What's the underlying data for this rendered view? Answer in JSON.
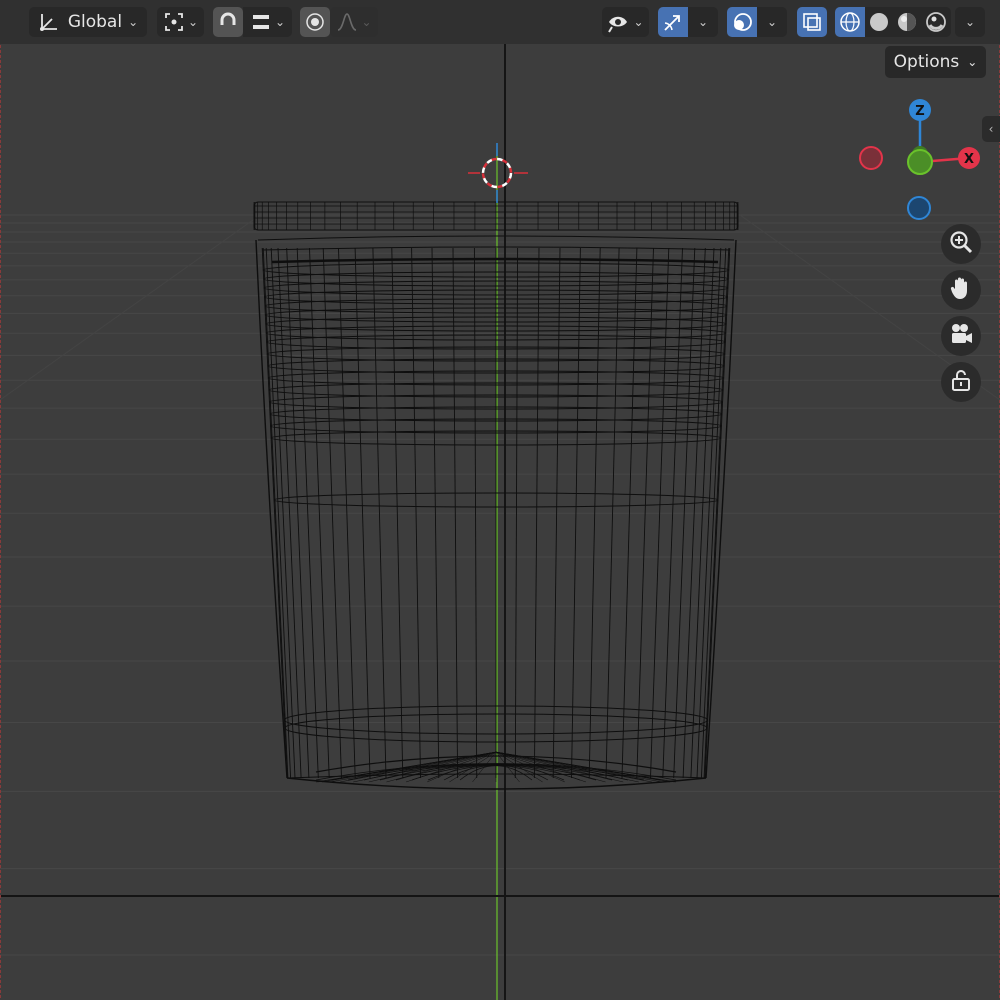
{
  "header": {
    "orientation_label": "Global",
    "orientation_icon": "transform-orientation-icon",
    "pivot_icon": "pivot-point-icon",
    "snap_icon": "snap-magnet-icon",
    "snap_target_icon": "snap-increment-icon",
    "proportional_icon": "proportional-editing-icon",
    "falloff_icon": "falloff-curve-icon",
    "visibility_icon": "object-visibility-icon",
    "gizmo_icon": "gizmo-toggle-icon",
    "overlay_icon": "overlays-icon",
    "xray_icon": "xray-toggle-icon",
    "shading_modes": [
      "wireframe",
      "solid",
      "material-preview",
      "rendered"
    ],
    "active_shading": "wireframe"
  },
  "options_label": "Options",
  "navigation_gizmo": {
    "axes": [
      "Z",
      "X"
    ],
    "z_label": "Z",
    "x_label": "X",
    "colors": {
      "x": "#e3344a",
      "y": "#6ac22b",
      "z": "#2f86d6"
    }
  },
  "nav_buttons": [
    "zoom-icon",
    "pan-hand-icon",
    "camera-view-icon",
    "lock-view-icon"
  ],
  "colors": {
    "background": "#3d3d3d",
    "header": "#303030",
    "active": "#4772b3",
    "wire": "#0e0e0e",
    "y_axis": "#6ac22b"
  }
}
